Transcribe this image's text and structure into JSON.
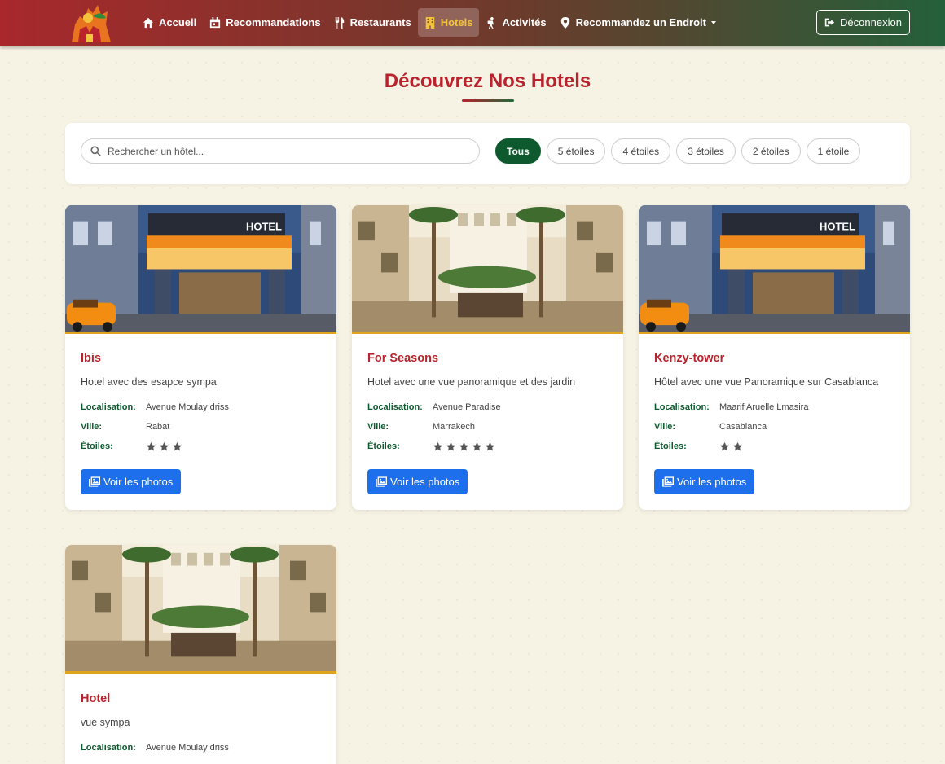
{
  "nav": {
    "items": [
      {
        "label": "Accueil",
        "icon": "home-icon"
      },
      {
        "label": "Recommandations",
        "icon": "calendar-icon"
      },
      {
        "label": "Restaurants",
        "icon": "utensils-icon"
      },
      {
        "label": "Hotels",
        "icon": "building-icon",
        "active": true
      },
      {
        "label": "Activités",
        "icon": "hiking-icon"
      },
      {
        "label": "Recommandez un Endroit",
        "icon": "map-pin-icon",
        "dropdown": true
      }
    ],
    "logout_label": "Déconnexion"
  },
  "page": {
    "title": "Découvrez Nos Hotels"
  },
  "search": {
    "placeholder": "Rechercher un hôtel..."
  },
  "filters": [
    "Tous",
    "5 étoiles",
    "4 étoiles",
    "3 étoiles",
    "2 étoiles",
    "1 étoile"
  ],
  "active_filter": "Tous",
  "labels": {
    "location": "Localisation:",
    "city": "Ville:",
    "stars": "Étoiles:",
    "photos_button": "Voir les photos"
  },
  "hotels": [
    {
      "name": "Ibis",
      "description": "Hotel avec des esapce sympa",
      "location": "Avenue Moulay driss",
      "city": "Rabat",
      "stars": 3,
      "image": "hotel-entrance"
    },
    {
      "name": "For Seasons",
      "description": "Hotel avec une vue panoramique et des jardin",
      "location": "Avenue Paradise",
      "city": "Marrakech",
      "stars": 5,
      "image": "hotel-atrium"
    },
    {
      "name": "Kenzy-tower",
      "description": "Hôtel avec une vue Panoramique sur Casablanca",
      "location": "Maarif Aruelle Lmasira",
      "city": "Casablanca",
      "stars": 2,
      "image": "hotel-entrance"
    },
    {
      "name": "Hotel",
      "description": "vue sympa",
      "location": "Avenue Moulay driss",
      "image": "hotel-atrium"
    }
  ],
  "colors": {
    "brand_red": "#b8232d",
    "brand_green": "#0e5a2e",
    "accent_gold": "#f3c33b",
    "button_blue": "#1d6fec"
  }
}
